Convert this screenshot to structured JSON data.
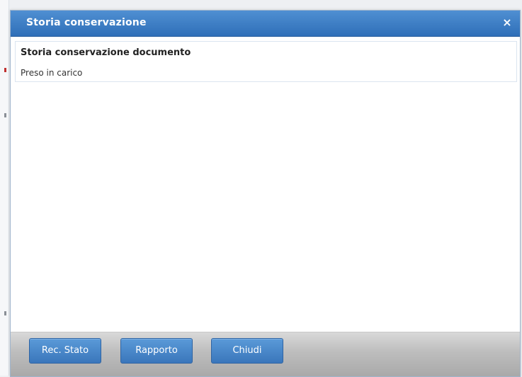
{
  "dialog": {
    "title": "Storia conservazione",
    "close_icon": "×"
  },
  "content": {
    "heading": "Storia conservazione documento",
    "status": "Preso in carico"
  },
  "footer": {
    "buttons": [
      {
        "label": "Rec. Stato"
      },
      {
        "label": "Rapporto"
      },
      {
        "label": "Chiudi"
      }
    ]
  },
  "colors": {
    "titlebar": "#3a7cc6",
    "button": "#4a88cb",
    "footer": "#bdbdbd"
  }
}
